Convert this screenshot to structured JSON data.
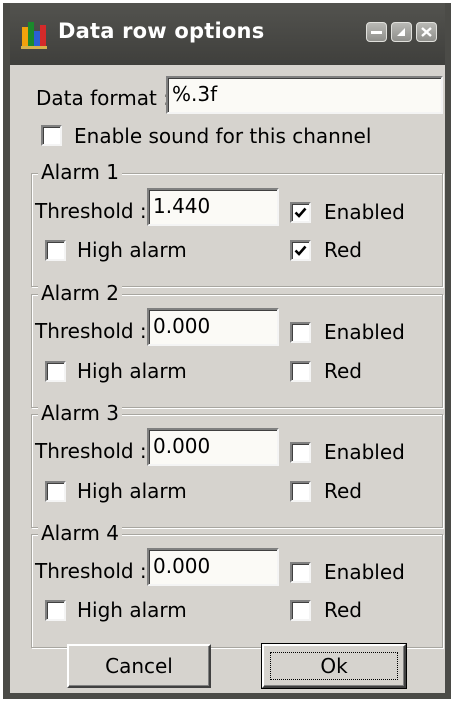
{
  "window": {
    "title": "Data row options"
  },
  "data_format": {
    "label": "Data format :",
    "value": "%.3f"
  },
  "sound": {
    "label": "Enable sound for this channel",
    "checked": false
  },
  "alarms": [
    {
      "title": "Alarm 1",
      "threshold_label": "Threshold :",
      "threshold": "1.440",
      "enabled_label": "Enabled",
      "enabled": true,
      "high_label": "High alarm",
      "high": false,
      "red_label": "Red",
      "red": true
    },
    {
      "title": "Alarm 2",
      "threshold_label": "Threshold :",
      "threshold": "0.000",
      "enabled_label": "Enabled",
      "enabled": false,
      "high_label": "High alarm",
      "high": false,
      "red_label": "Red",
      "red": false
    },
    {
      "title": "Alarm 3",
      "threshold_label": "Threshold :",
      "threshold": "0.000",
      "enabled_label": "Enabled",
      "enabled": false,
      "high_label": "High alarm",
      "high": false,
      "red_label": "Red",
      "red": false
    },
    {
      "title": "Alarm 4",
      "threshold_label": "Threshold :",
      "threshold": "0.000",
      "enabled_label": "Enabled",
      "enabled": false,
      "high_label": "High alarm",
      "high": false,
      "red_label": "Red",
      "red": false
    }
  ],
  "buttons": {
    "cancel_label": "Cancel",
    "ok_label": "Ok"
  },
  "icons": {
    "app": "bar-chart-icon",
    "minimize": "minimize-icon",
    "maximize": "maximize-icon",
    "close": "close-icon"
  }
}
